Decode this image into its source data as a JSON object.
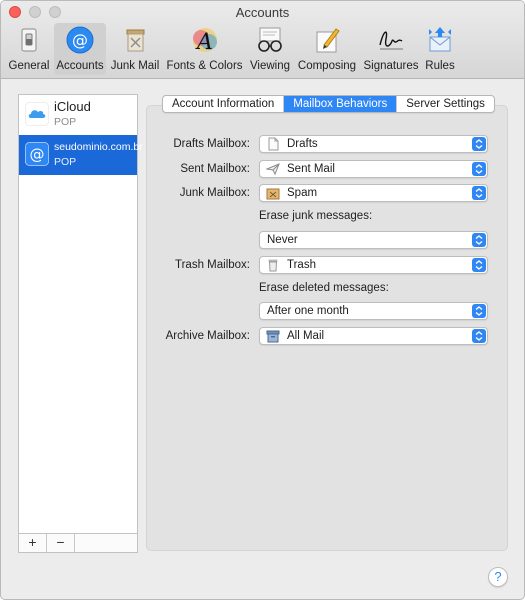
{
  "window": {
    "title": "Accounts"
  },
  "toolbar": {
    "items": [
      {
        "label": "General",
        "icon": "switch-icon"
      },
      {
        "label": "Accounts",
        "icon": "at-sign-icon",
        "selected": true
      },
      {
        "label": "Junk Mail",
        "icon": "trash-bin-icon"
      },
      {
        "label": "Fonts & Colors",
        "icon": "font-a-icon"
      },
      {
        "label": "Viewing",
        "icon": "glasses-icon"
      },
      {
        "label": "Composing",
        "icon": "pencil-paper-icon"
      },
      {
        "label": "Signatures",
        "icon": "signature-icon"
      },
      {
        "label": "Rules",
        "icon": "envelope-arrows-icon"
      }
    ]
  },
  "sidebar": {
    "accounts": [
      {
        "name": "iCloud",
        "type": "POP",
        "icon": "cloud-icon"
      },
      {
        "name": "seudominio.com.br",
        "type": "POP",
        "icon": "at-sign-icon",
        "selected": true
      }
    ],
    "add_label": "+",
    "remove_label": "−"
  },
  "tabs": [
    {
      "label": "Account Information"
    },
    {
      "label": "Mailbox Behaviors",
      "active": true
    },
    {
      "label": "Server Settings"
    }
  ],
  "form": {
    "drafts_label": "Drafts Mailbox:",
    "drafts_value": "Drafts",
    "sent_label": "Sent Mailbox:",
    "sent_value": "Sent Mail",
    "junk_label": "Junk Mailbox:",
    "junk_value": "Spam",
    "erase_junk_label": "Erase junk messages:",
    "erase_junk_value": "Never",
    "trash_label": "Trash Mailbox:",
    "trash_value": "Trash",
    "erase_deleted_label": "Erase deleted messages:",
    "erase_deleted_value": "After one month",
    "archive_label": "Archive Mailbox:",
    "archive_value": "All Mail"
  },
  "help": {
    "label": "?"
  },
  "colors": {
    "accent": "#2f86f5",
    "selection": "#1b68d9"
  }
}
